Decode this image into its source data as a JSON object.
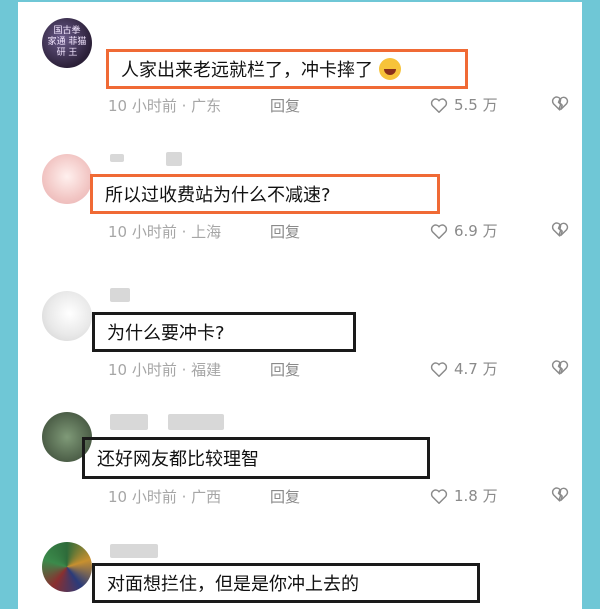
{
  "comments": [
    {
      "avatar_text": [
        "国古拳",
        "家通 菲猫",
        "研 王"
      ],
      "text": "人家出来老远就栏了，冲卡摔了",
      "has_emoji": true,
      "meta": "10 小时前 · 广东",
      "reply": "回复",
      "likes": "5.5 万",
      "highlight": "orange"
    },
    {
      "text": "所以过收费站为什么不减速?",
      "meta": "10 小时前 · 上海",
      "reply": "回复",
      "likes": "6.9 万",
      "highlight": "orange"
    },
    {
      "text": "为什么要冲卡?",
      "meta": "10 小时前 · 福建",
      "reply": "回复",
      "likes": "4.7 万",
      "highlight": "black"
    },
    {
      "text": "还好网友都比较理智",
      "meta": "10 小时前 · 广西",
      "reply": "回复",
      "likes": "1.8 万",
      "highlight": "black"
    },
    {
      "text": "对面想拦住，但是是你冲上去的",
      "highlight": "black"
    }
  ],
  "icons": {
    "like": "heart-outline-icon",
    "dislike": "broken-heart-icon"
  },
  "colors": {
    "background": "#6fc7d6",
    "orange_highlight": "#f06a35",
    "black_highlight": "#1a1a1a"
  }
}
